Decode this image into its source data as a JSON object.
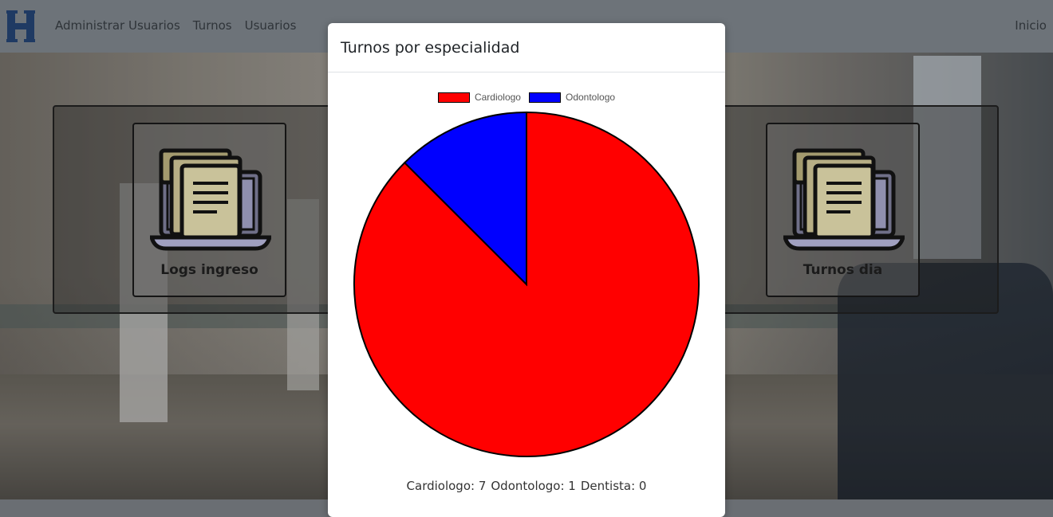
{
  "navbar": {
    "logo_letter": "H",
    "links": [
      "Administrar Usuarios",
      "Turnos",
      "Usuarios"
    ],
    "right_link": "Inicio"
  },
  "cards": [
    {
      "label": "Logs ingreso",
      "icon": "documents-laptop-icon"
    },
    {
      "label": "Turnos dia",
      "icon": "documents-laptop-icon"
    }
  ],
  "modal": {
    "title": "Turnos por especialidad"
  },
  "chart_data": {
    "type": "pie",
    "categories": [
      "Cardiologo",
      "Odontologo"
    ],
    "values": [
      7,
      1
    ],
    "colors": [
      "#ff0000",
      "#0000ff"
    ],
    "legend": "top",
    "summary": [
      {
        "label": "Cardiologo",
        "value": 7
      },
      {
        "label": "Odontologo",
        "value": 1
      },
      {
        "label": "Dentista",
        "value": 0
      }
    ]
  },
  "colors": {
    "navbar": "#6d7379",
    "logo": "#1f3a63"
  }
}
